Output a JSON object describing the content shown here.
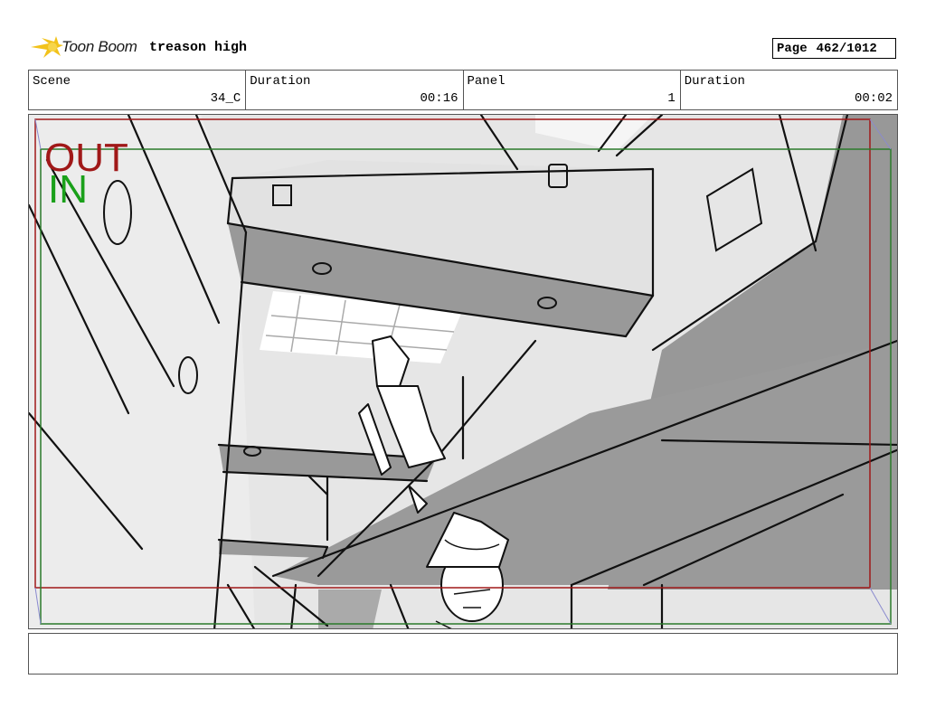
{
  "header": {
    "logo_text": "Toon Boom",
    "project_title": "treason high",
    "page_label": "Page",
    "page_value": "462/1012"
  },
  "info": [
    {
      "label": "Scene",
      "value": "34_C"
    },
    {
      "label": "Duration",
      "value": "00:16"
    },
    {
      "label": "Panel",
      "value": "1"
    },
    {
      "label": "Duration",
      "value": "00:02"
    }
  ],
  "panel": {
    "out_label": "OUT",
    "in_label": "IN",
    "out_color": "#a01818",
    "in_color": "#1aa01a"
  },
  "caption": {
    "text": ""
  }
}
